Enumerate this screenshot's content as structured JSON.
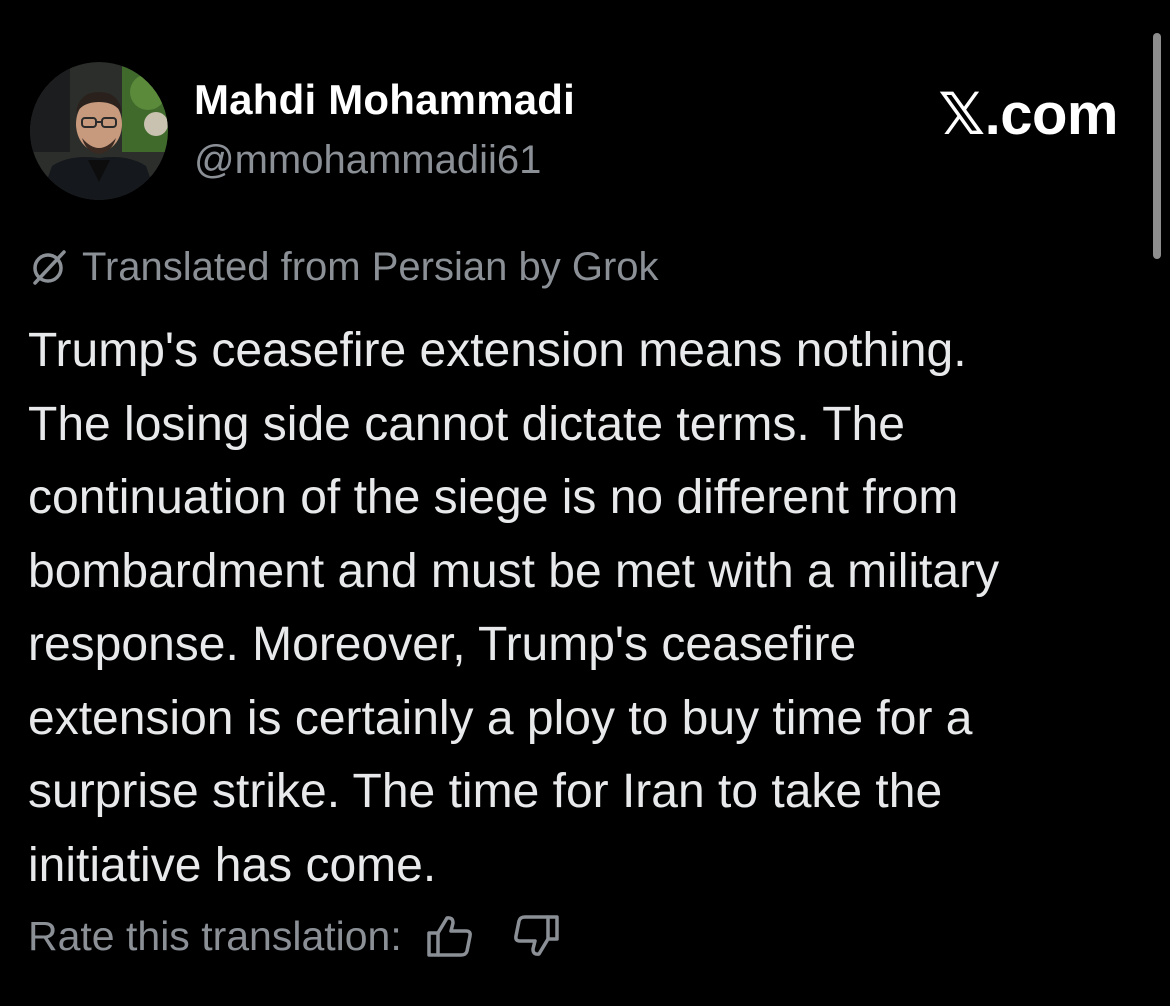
{
  "author": {
    "display_name": "Mahdi Mohammadi",
    "handle": "@mmohammadii61",
    "avatar_icon": "profile-photo"
  },
  "brand": {
    "label": "𝕏.com"
  },
  "translation": {
    "icon": "grok-icon",
    "label": "Translated from Persian by Grok"
  },
  "post": {
    "lines": [
      "Trump's ceasefire extension means nothing.",
      "The losing side cannot dictate terms. The",
      "continuation of the siege is no different from",
      "bombardment and must be met with a military",
      "response. Moreover, Trump's ceasefire",
      "extension is certainly a ploy to buy time for a",
      "surprise strike. The time for Iran to take the",
      "initiative has come."
    ]
  },
  "rating": {
    "label": "Rate this translation:",
    "up_icon": "thumbs-up-icon",
    "down_icon": "thumbs-down-icon"
  },
  "colors": {
    "background": "#000000",
    "primary_text": "#e7e9ea",
    "secondary_text": "#8b9096"
  }
}
